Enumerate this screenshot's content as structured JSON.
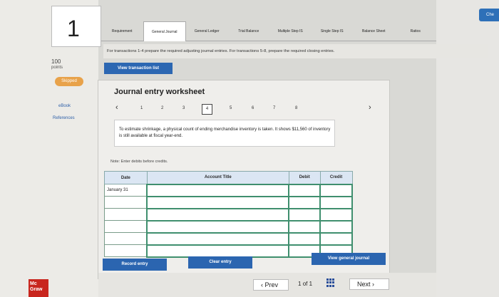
{
  "question": {
    "number": "1",
    "points_value": "100",
    "points_label": "points",
    "status": "Skipped",
    "ebook": "eBook",
    "references": "References"
  },
  "brand": {
    "logo_text": "Mc Graw"
  },
  "check_label": "Che",
  "tabs": [
    "Requirement",
    "General Journal",
    "General Ledger",
    "Trial Balance",
    "Multiple Step IS",
    "Single Step IS",
    "Balance Sheet",
    "Ratios"
  ],
  "instructions": "For transactions 1-4 prepare the required adjusting journal entries. For transactions 5-8, prepare the required closing entries.",
  "view_transaction_list": "View transaction list",
  "worksheet": {
    "title": "Journal entry worksheet",
    "steps": [
      "1",
      "2",
      "3",
      "4",
      "5",
      "6",
      "7",
      "8"
    ],
    "active_step": "4",
    "description": "To estimate shrinkage, a physical count of ending merchandise inventory is taken. It shows $11,560 of inventory is still available at fiscal year-end.",
    "note": "Note: Enter debits before credits.",
    "columns": [
      "Date",
      "Account Title",
      "Debit",
      "Credit"
    ],
    "rows": [
      [
        "January 31",
        "",
        "",
        ""
      ],
      [
        "",
        "",
        "",
        ""
      ],
      [
        "",
        "",
        "",
        ""
      ],
      [
        "",
        "",
        "",
        ""
      ],
      [
        "",
        "",
        "",
        ""
      ],
      [
        "",
        "",
        "",
        ""
      ]
    ],
    "record_entry": "Record entry",
    "clear_entry": "Clear entry",
    "view_general_journal": "View general journal"
  },
  "pager": {
    "prev": "Prev",
    "page": "1",
    "of": "of",
    "total": "1",
    "next": "Next"
  },
  "colors": {
    "primary_blue": "#2b65b0",
    "skipped_orange": "#e8a24a",
    "table_border_green": "#3f8f6e",
    "logo_red": "#c8261e"
  }
}
